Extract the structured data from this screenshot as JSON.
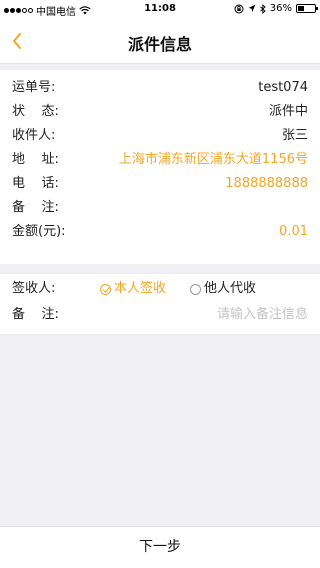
{
  "status_bar": {
    "carrier": "中国电信",
    "time": "11:08",
    "battery": "36%",
    "battery_level": 0.36
  },
  "nav": {
    "title": "派件信息"
  },
  "info": {
    "rows": [
      {
        "label": "运单号:",
        "value": "test074"
      },
      {
        "label": "状    态:",
        "value": "派件中"
      },
      {
        "label": "收件人:",
        "value": "张三"
      },
      {
        "label": "地    址:",
        "value": "上海市浦东新区浦东大道1156号"
      },
      {
        "label": "电    话:",
        "value": "1888888888"
      },
      {
        "label": "备    注:",
        "value": ""
      },
      {
        "label": "金额(元):",
        "value": "0.01"
      }
    ]
  },
  "sign": {
    "label": "签收人:",
    "options": [
      {
        "label": "本人签收",
        "checked": true
      },
      {
        "label": "他人代收",
        "checked": false
      }
    ],
    "remark_label": "备    注:",
    "remark_placeholder": "请输入备注信息"
  },
  "footer": {
    "next_label": "下一步"
  },
  "colors": {
    "accent": "#f5a623",
    "background": "#efeff4"
  }
}
